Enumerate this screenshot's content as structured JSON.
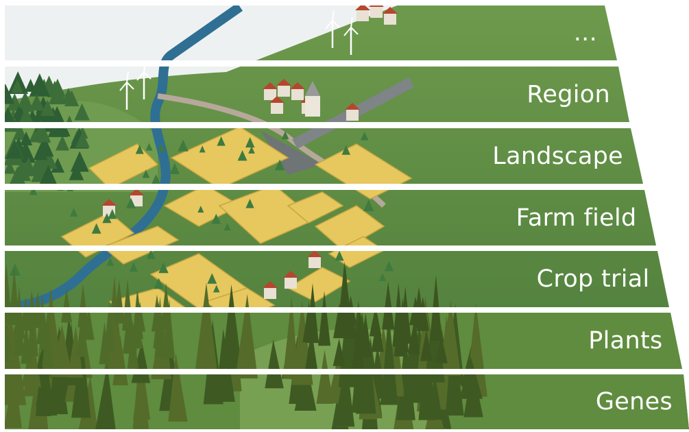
{
  "levels": [
    {
      "label": "...",
      "color": "#9cb9b8"
    },
    {
      "label": "Region",
      "color": "#8cb1ad"
    },
    {
      "label": "Landscape",
      "color": "#7aa7a2"
    },
    {
      "label": "Farm field",
      "color": "#4e8a84"
    },
    {
      "label": "Crop trial",
      "color": "#3b7a73"
    },
    {
      "label": "Plants",
      "color": "#1d5e59"
    },
    {
      "label": "Genes",
      "color": "#4a5572"
    }
  ],
  "scene": {
    "sky_color": "#eef1f1",
    "grass_color": "#5a8f4a",
    "field_color": "#e6c85f",
    "forest_color": "#4f6b2a"
  }
}
